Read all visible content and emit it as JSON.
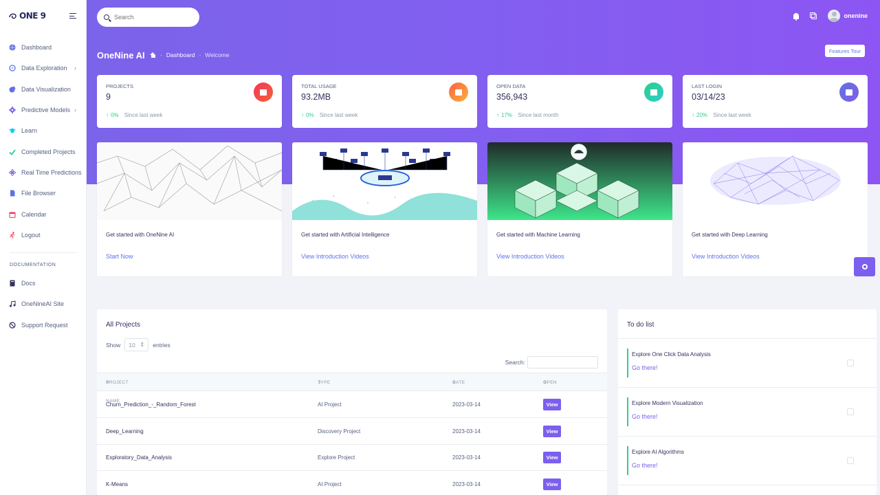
{
  "brand": {
    "logo_text": "ONE 9"
  },
  "sidebar": {
    "items": [
      {
        "label": "Dashboard",
        "icon": "globe-icon",
        "color": "#5e72e4"
      },
      {
        "label": "Data Exploration",
        "icon": "compass-icon",
        "color": "#5e72e4",
        "has_submenu": true
      },
      {
        "label": "Data Visualization",
        "icon": "chart-icon",
        "color": "#5e72e4"
      },
      {
        "label": "Predictive Models",
        "icon": "cog-icon",
        "color": "#825ff0",
        "has_submenu": true
      },
      {
        "label": "Learn",
        "icon": "graduation-cap-icon",
        "color": "#11cdef"
      },
      {
        "label": "Completed Projects",
        "icon": "check-icon",
        "color": "#2dce89"
      },
      {
        "label": "Real Time Predictions",
        "icon": "atom-icon",
        "color": "#825ff0"
      },
      {
        "label": "File Browser",
        "icon": "file-icon",
        "color": "#5e72e4"
      },
      {
        "label": "Calendar",
        "icon": "calendar-icon",
        "color": "#f5365c"
      },
      {
        "label": "Logout",
        "icon": "running-icon",
        "color": "#f5365c"
      }
    ],
    "doc_heading": "DOCUMENTATION",
    "doc_items": [
      {
        "label": "Docs",
        "icon": "book-icon"
      },
      {
        "label": "OneNineAI Site",
        "icon": "music-note-icon"
      },
      {
        "label": "Support Request",
        "icon": "support-icon"
      }
    ]
  },
  "header": {
    "search_placeholder": "Search",
    "username": "onenine",
    "page_title": "OneNine AI",
    "breadcrumb": [
      "Dashboard",
      "Welcome"
    ],
    "features_tour": "Features Tour"
  },
  "stats": [
    {
      "label": "PROJECTS",
      "value": "9",
      "change": "0%",
      "period": "Since last week",
      "color": "#f5365c"
    },
    {
      "label": "TOTAL USAGE",
      "value": "93.2MB",
      "change": "0%",
      "period": "Since last week",
      "color": "#fb6340"
    },
    {
      "label": "OPEN DATA",
      "value": "356,943",
      "change": "17%",
      "period": "Since last month",
      "color": "#2dce89"
    },
    {
      "label": "LAST LOGIN",
      "value": "03/14/23",
      "change": "20%",
      "period": "Since last week",
      "color": "#5e72e4"
    }
  ],
  "intro_cards": [
    {
      "caption": "Get started with OneNine AI",
      "link": "Start Now"
    },
    {
      "caption": "Get started with Artificial Intelligence",
      "link": "View Introduction Videos"
    },
    {
      "caption": "Get started with Machine Learning",
      "link": "View Introduction Videos"
    },
    {
      "caption": "Get started with Deep Learning",
      "link": "View Introduction Videos"
    }
  ],
  "projects": {
    "title": "All Projects",
    "show": "Show",
    "entries_value": "10",
    "entries": "entries",
    "search_label": "Search:",
    "columns": [
      "PROJECT NAME",
      "TYPE",
      "DATE",
      "OPEN"
    ],
    "rows": [
      {
        "name": "Churn_Prediction_-_Random_Forest",
        "type": "AI Project",
        "date": "2023-03-14",
        "action": "View"
      },
      {
        "name": "Deep_Learning",
        "type": "Discovery Project",
        "date": "2023-03-14",
        "action": "View"
      },
      {
        "name": "Exploratory_Data_Analysis",
        "type": "Explore Project",
        "date": "2023-03-14",
        "action": "View"
      },
      {
        "name": "K-Means",
        "type": "AI Project",
        "date": "2023-03-14",
        "action": "View"
      }
    ]
  },
  "todo": {
    "title": "To do list",
    "items": [
      {
        "title": "Explore One Click Data Analysis",
        "link": "Go there!"
      },
      {
        "title": "Explore Modern Visualization",
        "link": "Go there!"
      },
      {
        "title": "Explore AI Algorithms",
        "link": "Go there!"
      }
    ]
  }
}
